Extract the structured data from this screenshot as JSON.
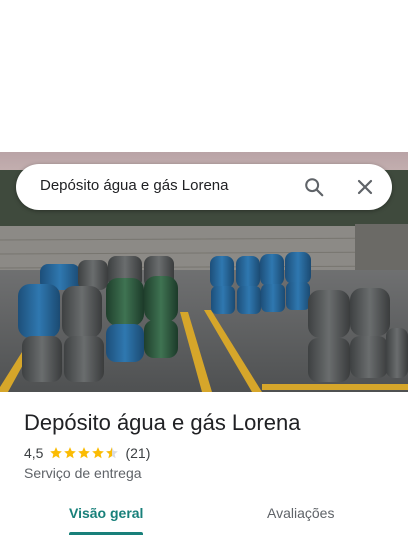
{
  "search": {
    "query": "Depósito água e gás Lorena"
  },
  "place": {
    "title": "Depósito água e gás Lorena",
    "rating": "4,5",
    "rating_value": 4.5,
    "review_count": "(21)",
    "category": "Serviço de entrega"
  },
  "tabs": [
    {
      "label": "Visão geral",
      "active": true
    },
    {
      "label": "Avaliações",
      "active": false
    }
  ],
  "colors": {
    "accent": "#18807a",
    "star": "#fbbc04"
  },
  "icons": {
    "search": "search-icon",
    "close": "close-icon"
  }
}
